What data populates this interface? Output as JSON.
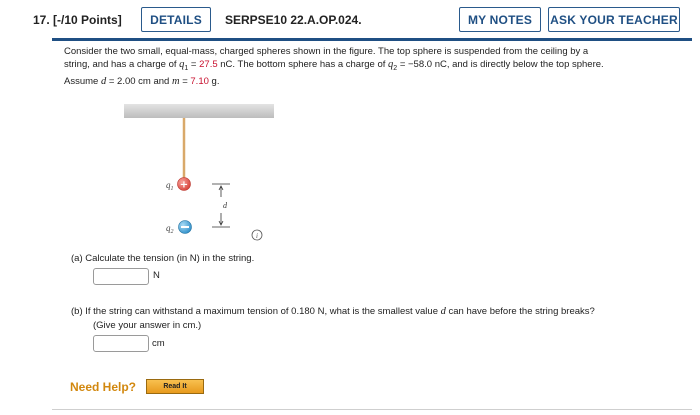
{
  "header": {
    "question_number": "17.  [-/10 Points]",
    "details_label": "DETAILS",
    "problem_code": "SERPSE10 22.A.OP.024.",
    "my_notes_label": "MY NOTES",
    "ask_teacher_label": "ASK YOUR TEACHER"
  },
  "problem": {
    "line1_a": "Consider the two small, equal-mass, charged spheres shown in the figure. The top sphere is suspended from the ceiling by a",
    "line2_a": "string, and has a charge of ",
    "q1_sym": "q",
    "q1_sub": "1",
    "eq1": " = ",
    "q1_value": "27.5",
    "q1_unit": " nC. The bottom sphere has a charge of ",
    "q2_sym": "q",
    "q2_sub": "2",
    "q2_text": " = −58.0 nC, and is directly below the top sphere.",
    "line3_a": "Assume ",
    "d_sym": "d",
    "d_text": " = 2.00 cm and ",
    "m_sym": "m",
    "eq3": " = ",
    "m_value": "7.10",
    "m_unit": " g."
  },
  "figure": {
    "q1_label": "q",
    "q1_label_sub": "1",
    "q2_label": "q",
    "q2_label_sub": "2",
    "d_label": "d",
    "info_icon": "info-icon",
    "colors": {
      "positive": "#e8584f",
      "negative": "#3fa0d8",
      "ceiling": "#cfcfcf",
      "string": "#d9a96a"
    }
  },
  "part_a": {
    "prompt": "(a)  Calculate the tension (in N) in the string.",
    "value": "",
    "unit": "N"
  },
  "part_b": {
    "prompt_line1": "(b)  If the string can withstand a maximum tension of 0.180 N, what is the smallest value ",
    "prompt_d": "d",
    "prompt_line1_end": " can have before the string breaks?",
    "prompt_line2": "(Give your answer in cm.)",
    "value": "",
    "unit": "cm"
  },
  "help": {
    "need_help": "Need Help?",
    "read_it": "Read It"
  }
}
